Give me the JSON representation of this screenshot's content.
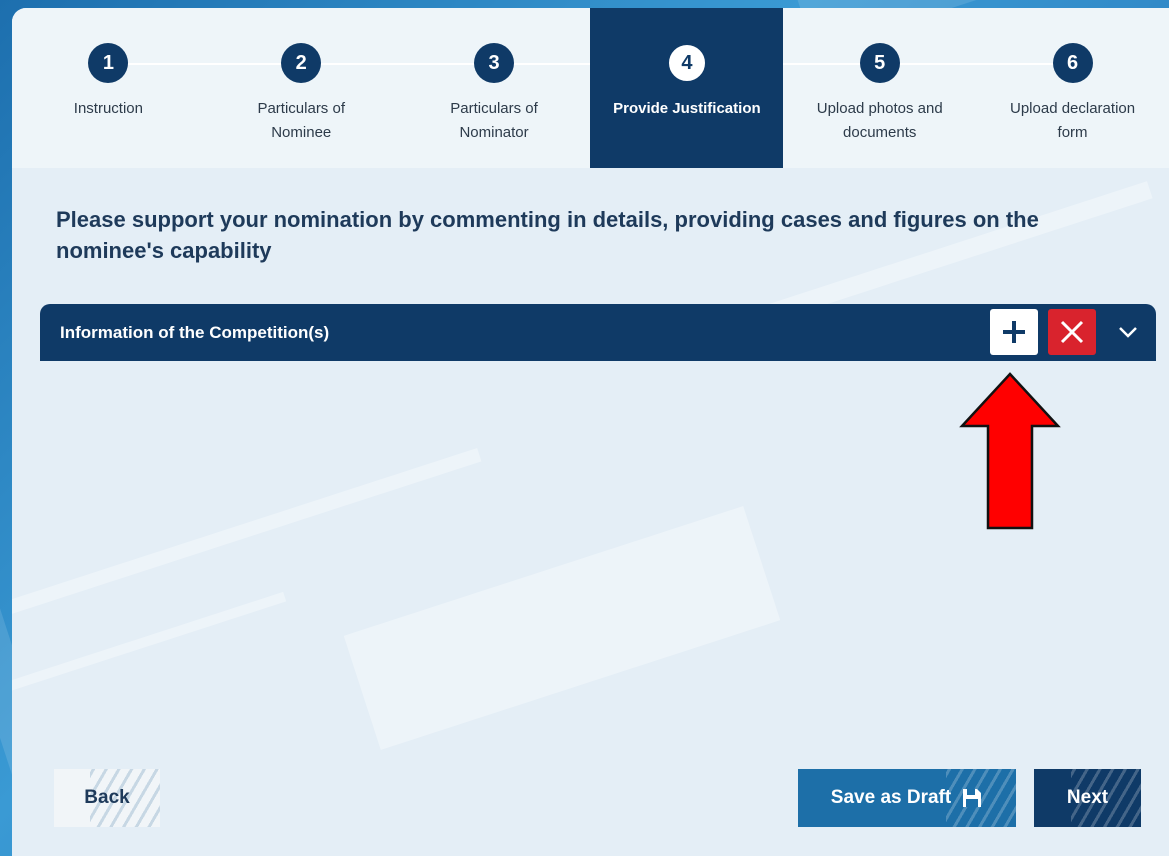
{
  "stepper": {
    "steps": [
      {
        "number": "1",
        "label": "Instruction"
      },
      {
        "number": "2",
        "label": "Particulars of Nominee"
      },
      {
        "number": "3",
        "label": "Particulars of Nominator"
      },
      {
        "number": "4",
        "label": "Provide Justification"
      },
      {
        "number": "5",
        "label": "Upload photos and documents"
      },
      {
        "number": "6",
        "label": "Upload declaration form"
      }
    ],
    "active_step": 4
  },
  "instruction_text": "Please support your nomination by commenting in details, providing cases and figures on the nominee's capability",
  "section": {
    "title": "Information of the Competition(s)",
    "add_icon": "plus-icon",
    "remove_icon": "close-icon",
    "collapse_icon": "chevron-down-icon"
  },
  "annotation": {
    "icon": "up-arrow-icon",
    "color": "#ff0000"
  },
  "footer": {
    "back_label": "Back",
    "save_draft_label": "Save as Draft",
    "save_draft_icon": "floppy-disk-icon",
    "next_label": "Next"
  },
  "colors": {
    "navy": "#0f3a67",
    "draft_blue": "#1d6fa8",
    "danger_red": "#d9232d",
    "panel_bg": "#e4eef6"
  }
}
